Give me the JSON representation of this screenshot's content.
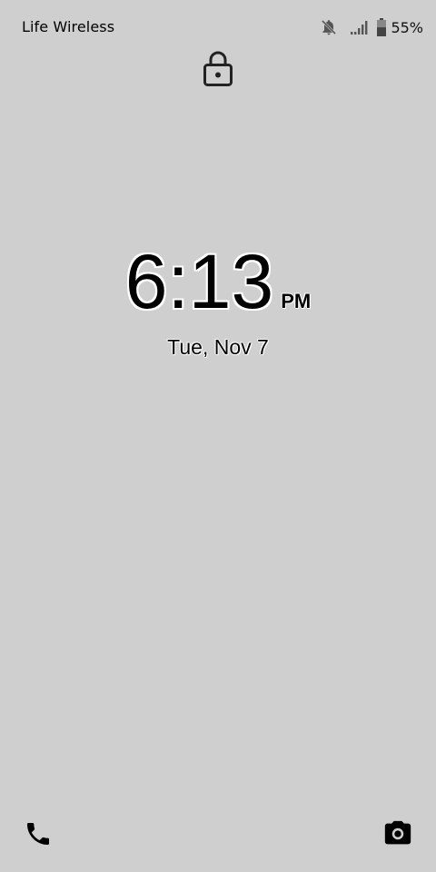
{
  "status_bar": {
    "carrier": "Life Wireless",
    "icons": [
      "bell-off-icon",
      "signal-icon",
      "battery-icon"
    ],
    "battery_level_percent": 55,
    "battery_text": "55%"
  },
  "lock_screen": {
    "lock_icon": "lock-icon",
    "time": "6:13",
    "ampm": "PM",
    "date": "Tue, Nov 7"
  },
  "shortcuts": {
    "left_icon": "phone-icon",
    "right_icon": "camera-icon"
  },
  "colors": {
    "background": "#cfcfcf",
    "text": "#000000",
    "outline": "#ffffff"
  }
}
